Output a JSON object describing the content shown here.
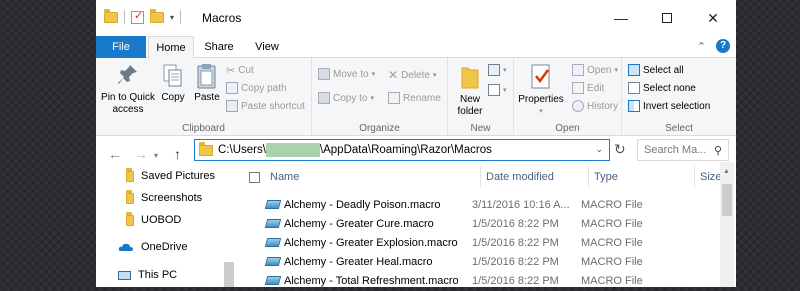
{
  "window": {
    "title": "Macros"
  },
  "ribbon_tabs": {
    "file": "File",
    "home": "Home",
    "share": "Share",
    "view": "View"
  },
  "clipboard": {
    "pin": "Pin to Quick access",
    "copy": "Copy",
    "paste": "Paste",
    "cut": "Cut",
    "copy_path": "Copy path",
    "paste_shortcut": "Paste shortcut",
    "label": "Clipboard"
  },
  "organize": {
    "move_to": "Move to",
    "copy_to": "Copy to",
    "delete": "Delete",
    "rename": "Rename",
    "label": "Organize"
  },
  "new_group": {
    "new_folder": "New folder",
    "label": "New"
  },
  "open_group": {
    "properties": "Properties",
    "open": "Open",
    "edit": "Edit",
    "history": "History",
    "label": "Open"
  },
  "select_group": {
    "select_all": "Select all",
    "select_none": "Select none",
    "invert": "Invert selection",
    "label": "Select"
  },
  "address": {
    "path_prefix": "C:\\Users\\",
    "path_suffix": "\\AppData\\Roaming\\Razor\\Macros"
  },
  "search": {
    "placeholder": "Search Ma..."
  },
  "nav_pane": {
    "items": [
      "Saved Pictures",
      "Screenshots",
      "UOBOD",
      "OneDrive",
      "This PC"
    ]
  },
  "columns": {
    "name": "Name",
    "date": "Date modified",
    "type": "Type",
    "size": "Size"
  },
  "files": [
    {
      "name": "Alchemy - Deadly Poison.macro",
      "date": "3/11/2016 10:16 A...",
      "type": "MACRO File"
    },
    {
      "name": "Alchemy - Greater Cure.macro",
      "date": "1/5/2016 8:22 PM",
      "type": "MACRO File"
    },
    {
      "name": "Alchemy - Greater Explosion.macro",
      "date": "1/5/2016 8:22 PM",
      "type": "MACRO File"
    },
    {
      "name": "Alchemy - Greater Heal.macro",
      "date": "1/5/2016 8:22 PM",
      "type": "MACRO File"
    },
    {
      "name": "Alchemy - Total Refreshment.macro",
      "date": "1/5/2016 8:22 PM",
      "type": "MACRO File"
    }
  ],
  "colors": {
    "accent": "#1979ca",
    "folder": "#f0c54a",
    "background": "#2b2d33"
  }
}
